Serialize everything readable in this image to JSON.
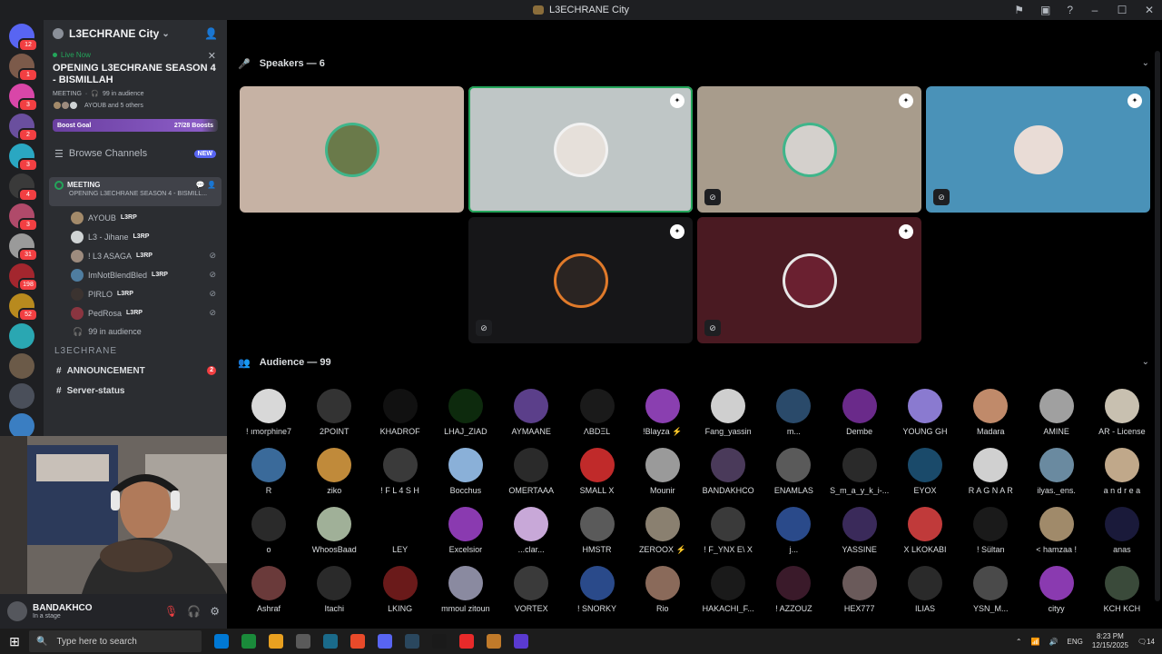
{
  "window": {
    "title": "L3ECHRANE City"
  },
  "server_rail": {
    "servers": [
      {
        "name": "discord-home",
        "badge": "12",
        "color": "#5865f2"
      },
      {
        "name": "server-1",
        "badge": "1",
        "color": "#7c5a4a"
      },
      {
        "name": "server-2",
        "badge": "3",
        "color": "#d946a8"
      },
      {
        "name": "server-3",
        "badge": "2",
        "color": "#6a4f9e"
      },
      {
        "name": "server-4",
        "badge": "3",
        "color": "#2aa7c2"
      },
      {
        "name": "server-5",
        "badge": "4",
        "color": "#3a3a3a"
      },
      {
        "name": "server-6",
        "badge": "3",
        "color": "#b04a6a"
      },
      {
        "name": "server-7",
        "badge": "31",
        "color": "#9a9a9a"
      },
      {
        "name": "server-8",
        "badge": "198",
        "color": "#a3262e"
      },
      {
        "name": "server-9",
        "badge": "52",
        "color": "#b88a1e"
      },
      {
        "name": "server-10",
        "badge": "",
        "color": "#2aa7b2"
      },
      {
        "name": "server-11",
        "badge": "",
        "color": "#6b5a48"
      },
      {
        "name": "server-12",
        "badge": "",
        "color": "#4a4f5a"
      },
      {
        "name": "server-13",
        "badge": "",
        "color": "#3a7ec2"
      }
    ]
  },
  "sidebar": {
    "server_name": "L3ECHRANE City",
    "live": {
      "label": "Live Now",
      "title": "OPENING L3ECHRANE SEASON 4 - BISMILLAH",
      "channel": "MEETING",
      "audience": "99 in audience",
      "participants": "AYOUB and 5 others"
    },
    "boost": {
      "label": "Boost Goal",
      "progress": "27/28 Boosts",
      "current": 27,
      "goal": 28
    },
    "browse": {
      "label": "Browse Channels",
      "badge": "NEW"
    },
    "meeting": {
      "name": "MEETING",
      "topic": "OPENING L3ECHRANE SEASON 4 - BISMILL..."
    },
    "voice_users": [
      {
        "name": "AYOUB",
        "tag": "L3RP",
        "muted": false,
        "color": "#a38a6a"
      },
      {
        "name": "L3 - Jihane",
        "tag": "L3RP",
        "muted": false,
        "color": "#cfd3d4"
      },
      {
        "name": "! L3 ASAGA",
        "tag": "L3RP",
        "muted": true,
        "color": "#9d8b7e"
      },
      {
        "name": "ImNotBlendBled",
        "tag": "L3RP",
        "muted": true,
        "color": "#4f7da0"
      },
      {
        "name": "PIRLO",
        "tag": "L3RP",
        "muted": true,
        "color": "#3b3330"
      },
      {
        "name": "PedRosa",
        "tag": "L3RP",
        "muted": true,
        "color": "#8a3540"
      }
    ],
    "audience_count": "99 in audience",
    "category": "L3ECHRANE",
    "channels": [
      {
        "name": "ANNOUNCEMENT",
        "count": "2"
      },
      {
        "name": "Server-status",
        "count": ""
      }
    ]
  },
  "user_panel": {
    "name": "BANDAKHCO",
    "status": "In a stage"
  },
  "stage": {
    "speakers_label": "Speakers — 6",
    "audience_label": "Audience — 99",
    "speakers": [
      {
        "name": "speaker-1",
        "bg": "#c6b2a4",
        "ring": "#3fb58a",
        "avatar": "#6a7a4a",
        "badge": false,
        "muted": false,
        "active": false
      },
      {
        "name": "speaker-2",
        "bg": "#bfc6c6",
        "ring": "#f2f2f2",
        "avatar": "#e6e0da",
        "badge": true,
        "muted": false,
        "active": true
      },
      {
        "name": "speaker-3",
        "bg": "#a89c8c",
        "ring": "#3fb58a",
        "avatar": "#d4d0cc",
        "badge": true,
        "muted": true,
        "active": false
      },
      {
        "name": "speaker-4",
        "bg": "#4a92b8",
        "ring": "#4a92b8",
        "avatar": "#e9dcd6",
        "badge": true,
        "muted": true,
        "active": false
      },
      {
        "name": "speaker-5",
        "bg": "#161618",
        "ring": "#e07a2a",
        "avatar": "#2a2422",
        "badge": true,
        "muted": true,
        "active": false
      },
      {
        "name": "speaker-6",
        "bg": "#4a1a22",
        "ring": "#e8e8e8",
        "avatar": "#6a2030",
        "badge": true,
        "muted": true,
        "active": false
      }
    ],
    "audience": [
      {
        "name": "! ımorphine7",
        "color": "#d8d8d8"
      },
      {
        "name": "2POINT",
        "color": "#333333"
      },
      {
        "name": "KHADROF",
        "color": "#111111"
      },
      {
        "name": "LHAJ_ZIAD",
        "color": "#0d2a0d"
      },
      {
        "name": "AYMAANE",
        "color": "#5b3f8a"
      },
      {
        "name": "ΛBDΞL",
        "color": "#1a1a1a"
      },
      {
        "name": "!Blayza ⚡",
        "color": "#8a3fb0"
      },
      {
        "name": "Fang_yassin",
        "color": "#cfcfcf"
      },
      {
        "name": "m...",
        "color": "#2a4a6a"
      },
      {
        "name": "Dembe",
        "color": "#6a2a8a"
      },
      {
        "name": "YOUNG GH",
        "color": "#8a7ad0"
      },
      {
        "name": "Madara",
        "color": "#c08a6a"
      },
      {
        "name": "AMINE",
        "color": "#a0a0a0"
      },
      {
        "name": "AR - License",
        "color": "#c8c0b0"
      },
      {
        "name": "R",
        "color": "#3a6a9a"
      },
      {
        "name": "ziko",
        "color": "#c08a3a"
      },
      {
        "name": "! F L 4 S H",
        "color": "#3a3a3a"
      },
      {
        "name": "Bocchus",
        "color": "#8ab0d8"
      },
      {
        "name": "OMERTAAA",
        "color": "#2a2a2a"
      },
      {
        "name": "SMALL X",
        "color": "#c02a2a"
      },
      {
        "name": "Mounir",
        "color": "#9a9a9a"
      },
      {
        "name": "BANDAKHCO",
        "color": "#4a3a5a"
      },
      {
        "name": "ENAMLAS",
        "color": "#5a5a5a"
      },
      {
        "name": "S_m_a_y_k_i-...",
        "color": "#2a2a2a"
      },
      {
        "name": "EYOX",
        "color": "#1a4a6a"
      },
      {
        "name": "R A G N A R",
        "color": "#d0d0d0"
      },
      {
        "name": "ilyas._ens.",
        "color": "#6a8aa0"
      },
      {
        "name": "a n d r e a",
        "color": "#c0a88a"
      },
      {
        "name": "o",
        "color": "#2a2a2a"
      },
      {
        "name": "WhoosBaad",
        "color": "#a0b098"
      },
      {
        "name": "LEY",
        "color": "#000000"
      },
      {
        "name": "Excelsior",
        "color": "#8a3ab0"
      },
      {
        "name": "...clar...",
        "color": "#c8a8d8"
      },
      {
        "name": "HMSTR",
        "color": "#5a5a5a"
      },
      {
        "name": "ZEROOX ⚡",
        "color": "#8a8070"
      },
      {
        "name": "! F_YNX E\\ X",
        "color": "#3a3a3a"
      },
      {
        "name": "j...",
        "color": "#2a4a8a"
      },
      {
        "name": "YASSINE",
        "color": "#3a2a5a"
      },
      {
        "name": "X LKOKABI",
        "color": "#c03a3a"
      },
      {
        "name": "! Sültan",
        "color": "#1a1a1a"
      },
      {
        "name": "< hamzaa !",
        "color": "#a08a6a"
      },
      {
        "name": "anas",
        "color": "#1a1a3a"
      },
      {
        "name": "Ashraf",
        "color": "#6a3a3a"
      },
      {
        "name": "Itachi",
        "color": "#2a2a2a"
      },
      {
        "name": "LKING",
        "color": "#6a1a1a"
      },
      {
        "name": "mmoul zitoun",
        "color": "#8a8aa0"
      },
      {
        "name": "VORTEX",
        "color": "#3a3a3a"
      },
      {
        "name": "! SNORKY",
        "color": "#2a4a8a"
      },
      {
        "name": "Rio",
        "color": "#8a6a5a"
      },
      {
        "name": "HAKACHI_F...",
        "color": "#1a1a1a"
      },
      {
        "name": "! AZZOUZ",
        "color": "#3a1a2a"
      },
      {
        "name": "HEX777",
        "color": "#6a5a5a"
      },
      {
        "name": "ILIAS",
        "color": "#2a2a2a"
      },
      {
        "name": "YSN_M...",
        "color": "#4a4a4a"
      },
      {
        "name": "cityy",
        "color": "#8a3ab0"
      },
      {
        "name": "KCH KCH",
        "color": "#3a4a3a"
      }
    ]
  },
  "taskbar": {
    "search_placeholder": "Type here to search",
    "language": "ENG",
    "time": "8:23 PM",
    "date": "12/15/2025",
    "notifications": "14",
    "apps": [
      "#0078d4",
      "#1a8a3a",
      "#e8a020",
      "#5a5a5a",
      "#1a6a8a",
      "#e84a2a",
      "#5865f2",
      "#2a475e",
      "#1a1a1a",
      "#e82a2a",
      "#c07a2a",
      "#5a3ad0"
    ]
  }
}
